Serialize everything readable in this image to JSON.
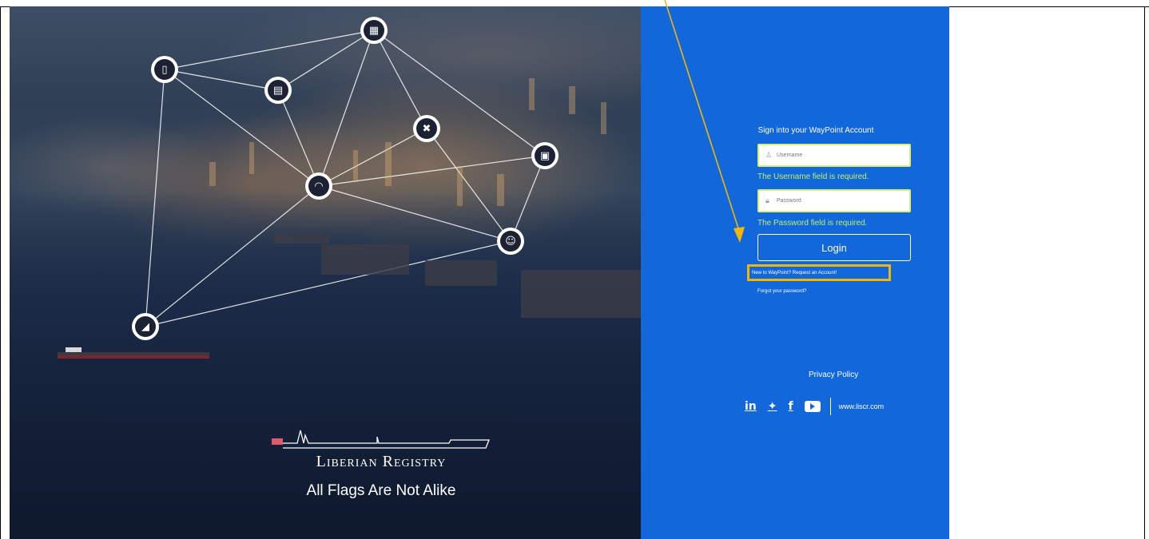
{
  "hero": {
    "brand_name": "Liberian Registry",
    "tagline": "All Flags Are Not Alike",
    "network_nodes": [
      {
        "icon": "qr-code-icon",
        "glyph": "▦"
      },
      {
        "icon": "mobile-phone-icon",
        "glyph": "▯"
      },
      {
        "icon": "document-icon",
        "glyph": "▤"
      },
      {
        "icon": "tools-icon",
        "glyph": "✖"
      },
      {
        "icon": "wifi-icon",
        "glyph": "◠"
      },
      {
        "icon": "tablet-icon",
        "glyph": "▣"
      },
      {
        "icon": "seafarer-id-icon",
        "glyph": "☺"
      },
      {
        "icon": "satellite-dish-icon",
        "glyph": "◢"
      }
    ]
  },
  "login": {
    "title": "Sign into your WayPoint Account",
    "username_placeholder": "Username",
    "username_error": "The Username field is required.",
    "password_placeholder": "Password",
    "password_error": "The Password field is required.",
    "login_label": "Login",
    "request_account_link": "New to WayPoint? Request an Account!",
    "forgot_password_link": "Forgot your password?"
  },
  "footer": {
    "privacy_policy": "Privacy Policy",
    "social": [
      {
        "icon": "linkedin-icon",
        "glyph": "in"
      },
      {
        "icon": "twitter-icon",
        "glyph": "🐦"
      },
      {
        "icon": "facebook-icon",
        "glyph": "f"
      },
      {
        "icon": "youtube-icon",
        "glyph": ""
      }
    ],
    "website": "www.liscr.com"
  },
  "annotation": {
    "highlight_color": "#f2b705"
  },
  "colors": {
    "panel_blue": "#1267db",
    "error_green": "#b9f26a",
    "field_border": "#d7f07a"
  }
}
